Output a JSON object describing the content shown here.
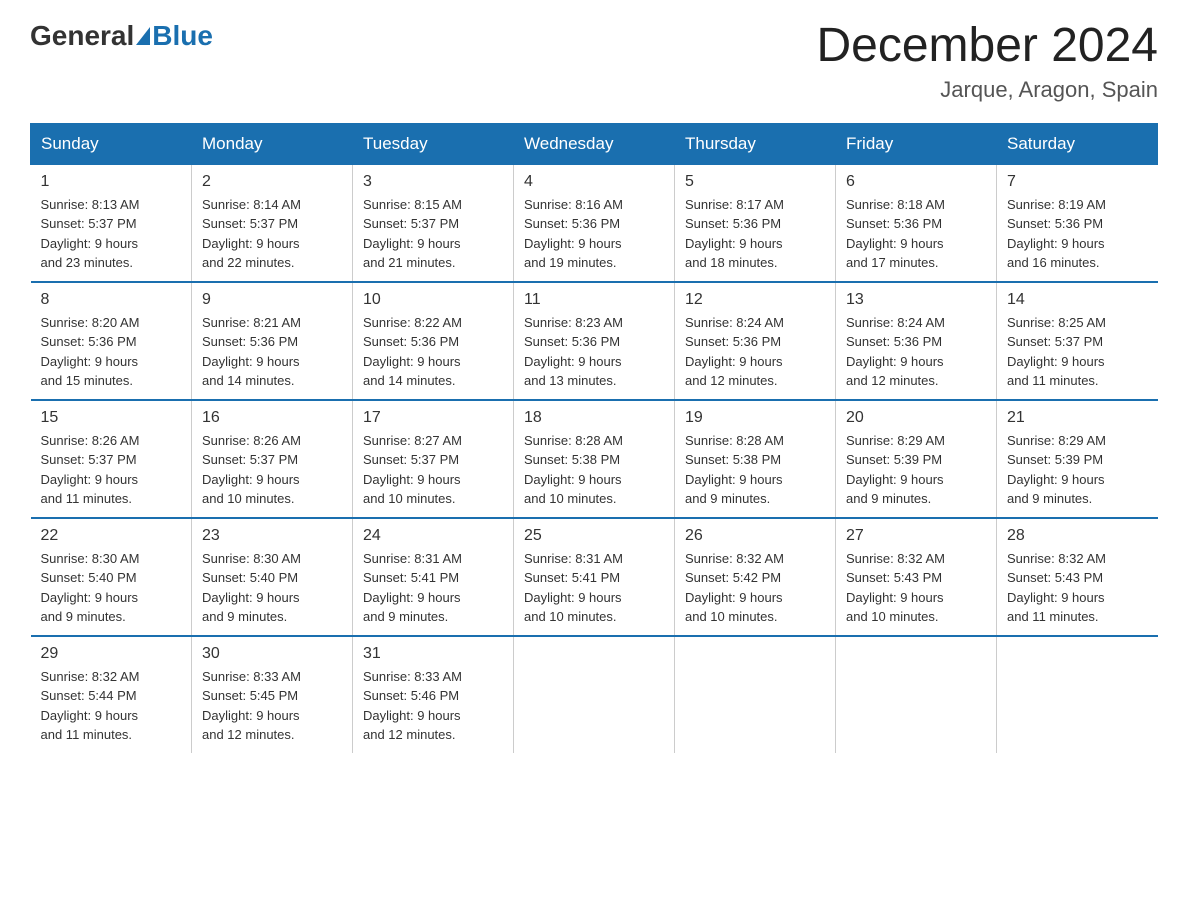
{
  "header": {
    "logo_general": "General",
    "logo_blue": "Blue",
    "month": "December 2024",
    "location": "Jarque, Aragon, Spain"
  },
  "days_of_week": [
    "Sunday",
    "Monday",
    "Tuesday",
    "Wednesday",
    "Thursday",
    "Friday",
    "Saturday"
  ],
  "weeks": [
    [
      {
        "num": "1",
        "sunrise": "8:13 AM",
        "sunset": "5:37 PM",
        "daylight": "9 hours and 23 minutes."
      },
      {
        "num": "2",
        "sunrise": "8:14 AM",
        "sunset": "5:37 PM",
        "daylight": "9 hours and 22 minutes."
      },
      {
        "num": "3",
        "sunrise": "8:15 AM",
        "sunset": "5:37 PM",
        "daylight": "9 hours and 21 minutes."
      },
      {
        "num": "4",
        "sunrise": "8:16 AM",
        "sunset": "5:36 PM",
        "daylight": "9 hours and 19 minutes."
      },
      {
        "num": "5",
        "sunrise": "8:17 AM",
        "sunset": "5:36 PM",
        "daylight": "9 hours and 18 minutes."
      },
      {
        "num": "6",
        "sunrise": "8:18 AM",
        "sunset": "5:36 PM",
        "daylight": "9 hours and 17 minutes."
      },
      {
        "num": "7",
        "sunrise": "8:19 AM",
        "sunset": "5:36 PM",
        "daylight": "9 hours and 16 minutes."
      }
    ],
    [
      {
        "num": "8",
        "sunrise": "8:20 AM",
        "sunset": "5:36 PM",
        "daylight": "9 hours and 15 minutes."
      },
      {
        "num": "9",
        "sunrise": "8:21 AM",
        "sunset": "5:36 PM",
        "daylight": "9 hours and 14 minutes."
      },
      {
        "num": "10",
        "sunrise": "8:22 AM",
        "sunset": "5:36 PM",
        "daylight": "9 hours and 14 minutes."
      },
      {
        "num": "11",
        "sunrise": "8:23 AM",
        "sunset": "5:36 PM",
        "daylight": "9 hours and 13 minutes."
      },
      {
        "num": "12",
        "sunrise": "8:24 AM",
        "sunset": "5:36 PM",
        "daylight": "9 hours and 12 minutes."
      },
      {
        "num": "13",
        "sunrise": "8:24 AM",
        "sunset": "5:36 PM",
        "daylight": "9 hours and 12 minutes."
      },
      {
        "num": "14",
        "sunrise": "8:25 AM",
        "sunset": "5:37 PM",
        "daylight": "9 hours and 11 minutes."
      }
    ],
    [
      {
        "num": "15",
        "sunrise": "8:26 AM",
        "sunset": "5:37 PM",
        "daylight": "9 hours and 11 minutes."
      },
      {
        "num": "16",
        "sunrise": "8:26 AM",
        "sunset": "5:37 PM",
        "daylight": "9 hours and 10 minutes."
      },
      {
        "num": "17",
        "sunrise": "8:27 AM",
        "sunset": "5:37 PM",
        "daylight": "9 hours and 10 minutes."
      },
      {
        "num": "18",
        "sunrise": "8:28 AM",
        "sunset": "5:38 PM",
        "daylight": "9 hours and 10 minutes."
      },
      {
        "num": "19",
        "sunrise": "8:28 AM",
        "sunset": "5:38 PM",
        "daylight": "9 hours and 9 minutes."
      },
      {
        "num": "20",
        "sunrise": "8:29 AM",
        "sunset": "5:39 PM",
        "daylight": "9 hours and 9 minutes."
      },
      {
        "num": "21",
        "sunrise": "8:29 AM",
        "sunset": "5:39 PM",
        "daylight": "9 hours and 9 minutes."
      }
    ],
    [
      {
        "num": "22",
        "sunrise": "8:30 AM",
        "sunset": "5:40 PM",
        "daylight": "9 hours and 9 minutes."
      },
      {
        "num": "23",
        "sunrise": "8:30 AM",
        "sunset": "5:40 PM",
        "daylight": "9 hours and 9 minutes."
      },
      {
        "num": "24",
        "sunrise": "8:31 AM",
        "sunset": "5:41 PM",
        "daylight": "9 hours and 9 minutes."
      },
      {
        "num": "25",
        "sunrise": "8:31 AM",
        "sunset": "5:41 PM",
        "daylight": "9 hours and 10 minutes."
      },
      {
        "num": "26",
        "sunrise": "8:32 AM",
        "sunset": "5:42 PM",
        "daylight": "9 hours and 10 minutes."
      },
      {
        "num": "27",
        "sunrise": "8:32 AM",
        "sunset": "5:43 PM",
        "daylight": "9 hours and 10 minutes."
      },
      {
        "num": "28",
        "sunrise": "8:32 AM",
        "sunset": "5:43 PM",
        "daylight": "9 hours and 11 minutes."
      }
    ],
    [
      {
        "num": "29",
        "sunrise": "8:32 AM",
        "sunset": "5:44 PM",
        "daylight": "9 hours and 11 minutes."
      },
      {
        "num": "30",
        "sunrise": "8:33 AM",
        "sunset": "5:45 PM",
        "daylight": "9 hours and 12 minutes."
      },
      {
        "num": "31",
        "sunrise": "8:33 AM",
        "sunset": "5:46 PM",
        "daylight": "9 hours and 12 minutes."
      },
      null,
      null,
      null,
      null
    ]
  ],
  "labels": {
    "sunrise": "Sunrise:",
    "sunset": "Sunset:",
    "daylight": "Daylight:"
  }
}
